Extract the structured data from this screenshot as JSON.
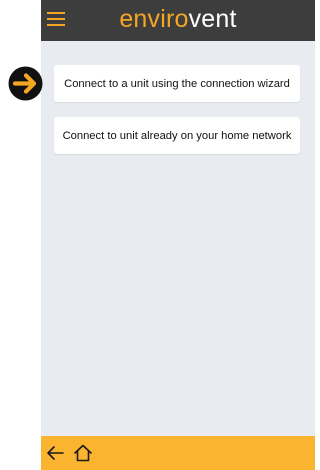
{
  "header": {
    "logo_part1": "enviro",
    "logo_part2": "vent",
    "menu_icon": "hamburger-menu-icon"
  },
  "actions": [
    {
      "label": "Connect to a unit using the connection wizard"
    },
    {
      "label": "Connect to unit already on your home network"
    }
  ],
  "footer": {
    "back_icon": "back-arrow-icon",
    "home_icon": "home-icon"
  },
  "colors": {
    "header_bg": "#3d3d3d",
    "accent": "#f5a623",
    "footer_bg": "#fbb42f",
    "content_bg": "#e8ebf0"
  }
}
